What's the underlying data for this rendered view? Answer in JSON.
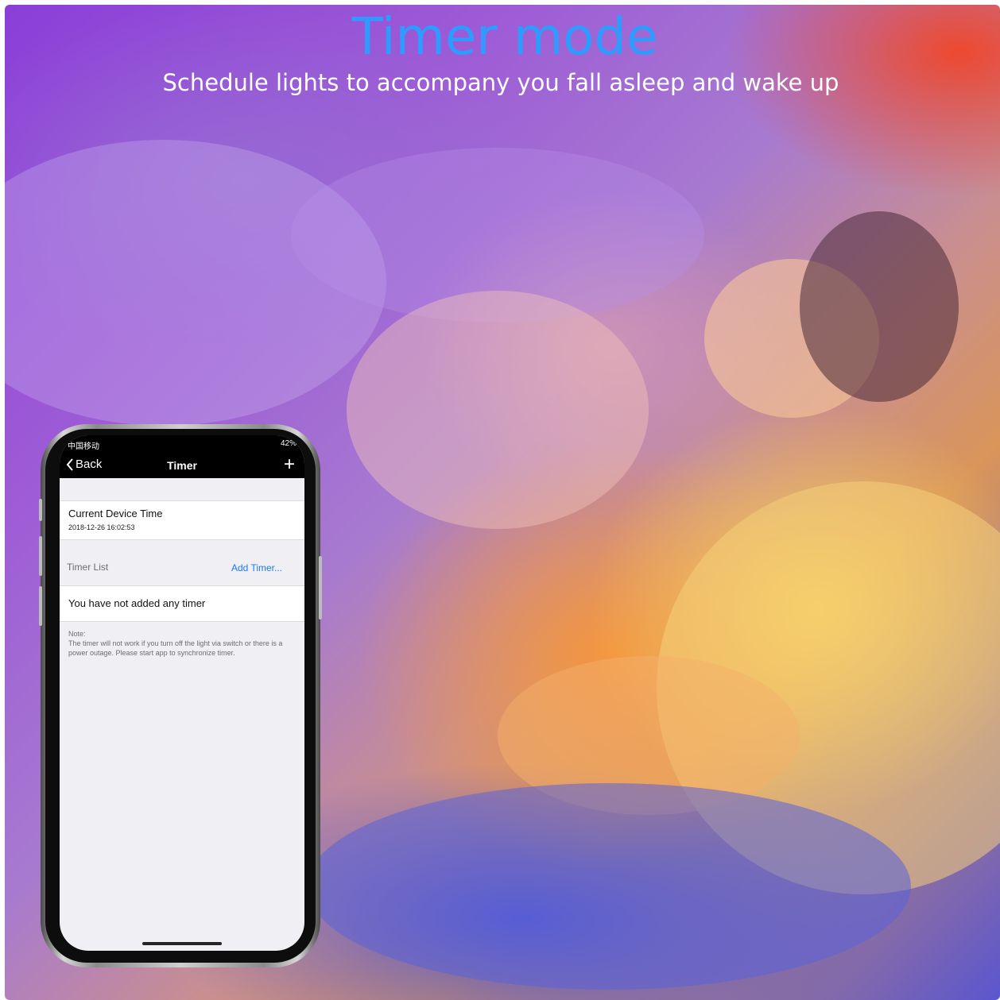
{
  "header": {
    "title": "Timer mode",
    "subtitle": "Schedule lights to accompany you fall asleep and wake up"
  },
  "phone": {
    "status": {
      "carrier": "中国移动",
      "battery": "42%"
    },
    "nav": {
      "back_label": "Back",
      "title": "Timer"
    },
    "device_time": {
      "label": "Current Device Time",
      "value": "2018-12-26 16:02:53"
    },
    "timer_list": {
      "label": "Timer List",
      "add_label": "Add Timer..."
    },
    "empty_message": "You have not added any timer",
    "note": {
      "heading": "Note:",
      "text": "The timer will not work if you turn off the light via switch or there is a power outage. Please start app to synchronize timer."
    }
  },
  "colors": {
    "title": "#2e9bff",
    "link": "#1c7cf4"
  }
}
